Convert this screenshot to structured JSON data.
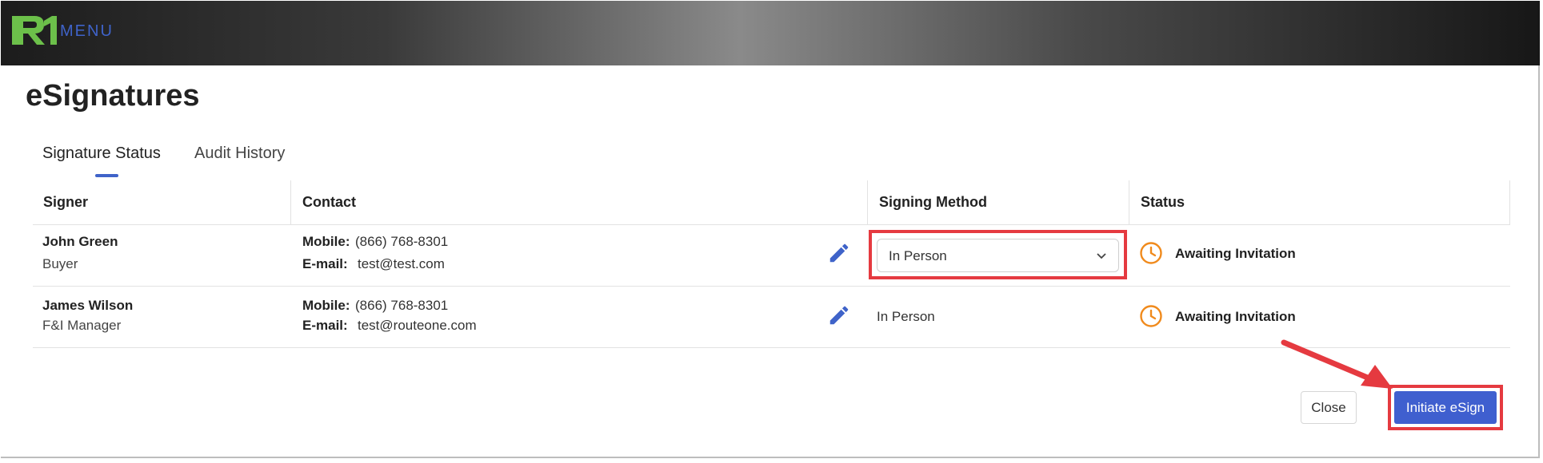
{
  "header": {
    "menu_label": "MENU",
    "logo_text": "R1",
    "logo_green": "#6cc04a",
    "logo_blue": "#3f63c9"
  },
  "page": {
    "title": "eSignatures"
  },
  "tabs": [
    {
      "label": "Signature Status",
      "active": true
    },
    {
      "label": "Audit History",
      "active": false
    }
  ],
  "table": {
    "columns": [
      "Signer",
      "Contact",
      "Signing Method",
      "Status"
    ],
    "rows": [
      {
        "name": "John Green",
        "role": "Buyer",
        "mobile_label": "Mobile:",
        "mobile": "(866) 768-8301",
        "email_label": "E-mail:",
        "email": "test@test.com",
        "signing_method": "In Person",
        "signing_method_is_dropdown": true,
        "status": "Awaiting Invitation",
        "status_icon": "clock-icon"
      },
      {
        "name": "James Wilson",
        "role": "F&I Manager",
        "mobile_label": "Mobile:",
        "mobile": "(866) 768-8301",
        "email_label": "E-mail:",
        "email": "test@routeone.com",
        "signing_method": "In Person",
        "signing_method_is_dropdown": false,
        "status": "Awaiting Invitation",
        "status_icon": "clock-icon"
      }
    ]
  },
  "actions": {
    "close_label": "Close",
    "primary_label": "Initiate eSign"
  },
  "colors": {
    "accent": "#3f5fcf",
    "status_orange": "#f08a1c",
    "highlight_red": "#e53a40",
    "edit_icon": "#3f63c9"
  }
}
